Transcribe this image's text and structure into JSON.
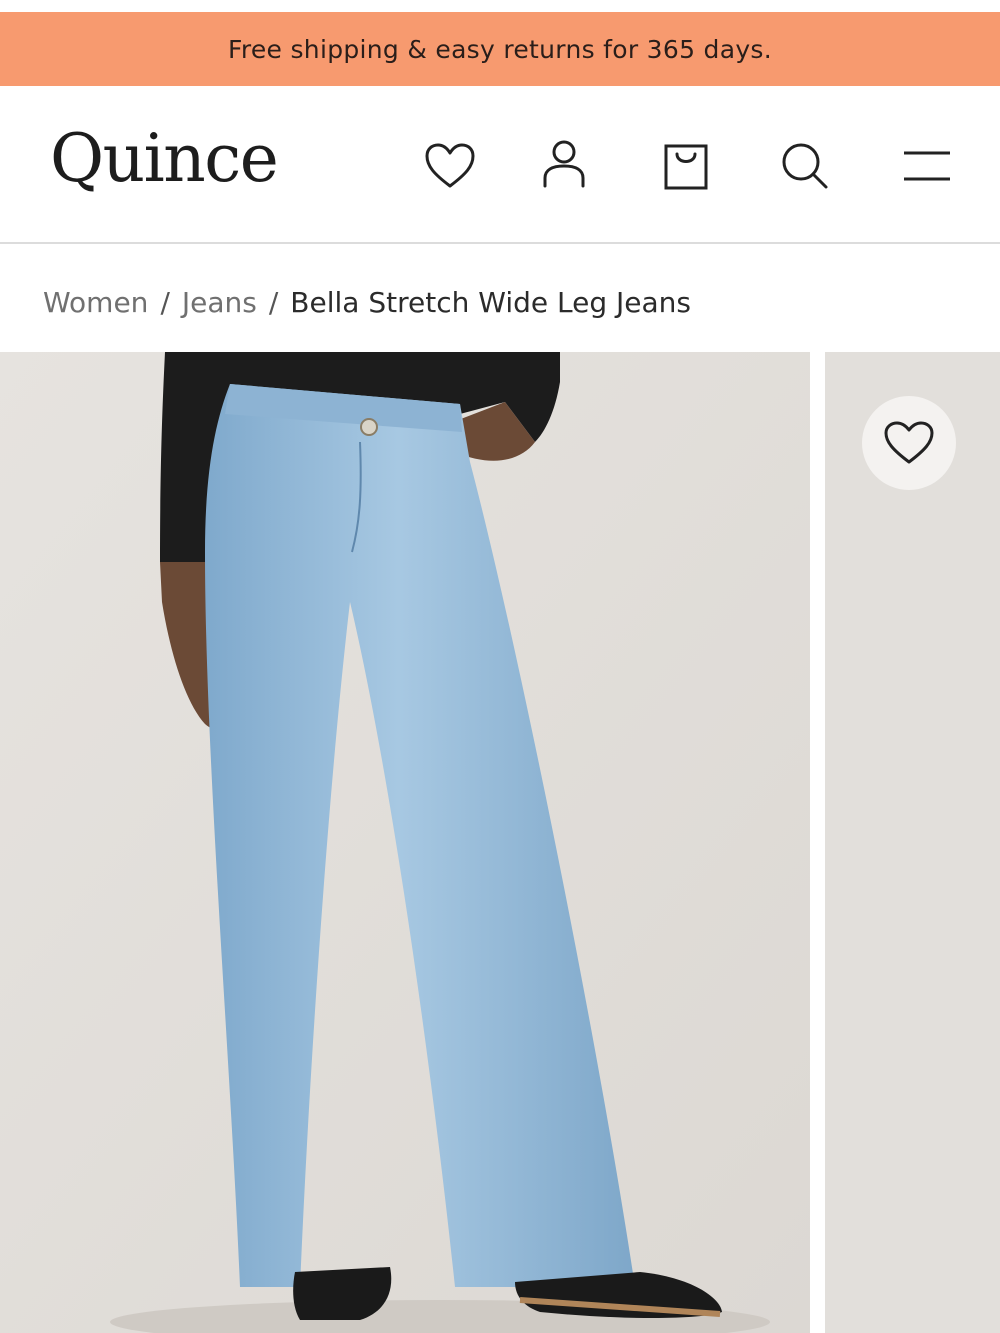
{
  "promo": {
    "text": "Free shipping & easy returns for 365 days."
  },
  "header": {
    "logo": "Quince",
    "icons": [
      "heart-icon",
      "account-icon",
      "shopping-bag-icon",
      "search-icon",
      "menu-icon"
    ]
  },
  "breadcrumb": {
    "items": [
      {
        "label": "Women"
      },
      {
        "label": "Jeans"
      },
      {
        "label": "Bella Stretch Wide Leg Jeans"
      }
    ],
    "separator": "/"
  },
  "gallery": {
    "favorite_icon": "heart-icon"
  },
  "colors": {
    "promo_bg": "#f79a6f",
    "denim": "#8fb8d9",
    "background": "#e4e1dd"
  }
}
